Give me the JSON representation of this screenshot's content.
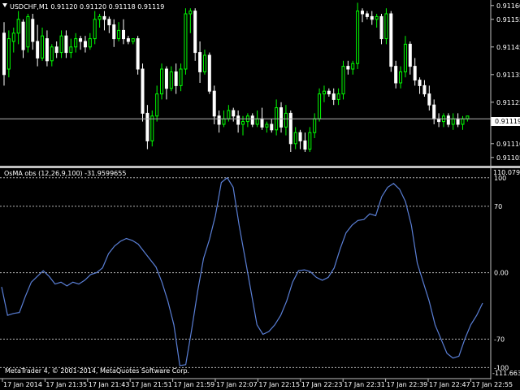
{
  "colors": {
    "background": "#000000",
    "bull_candle": "#00ff00",
    "bear_candle": "#ffffff",
    "osma_line": "#5a7fd6",
    "grid": "#b4b4b4",
    "text": "#ffffff",
    "separator": "#c0c0c0"
  },
  "main_panel": {
    "title": "USDCHF,M1  0.91120 0.91120 0.91118 0.91119",
    "price_ticks": [
      "0.91160",
      "0.91155",
      "0.91145",
      "0.91135",
      "0.91125",
      "0.91110",
      "0.91105"
    ],
    "current_price_label": "0.91119"
  },
  "indicator_panel": {
    "title": "OsMA obs (12,26,9,100) -31.9599655",
    "top_label": "110.0791",
    "bottom_label": "-111.6630",
    "level_labels": [
      "100",
      "70",
      "0.00",
      "-70",
      "-100"
    ]
  },
  "copyright": "MetaTrader 4, © 2001-2014, MetaQuotes Software Corp.",
  "time_labels": [
    "17 Jan 2014",
    "17 Jan 21:35",
    "17 Jan 21:43",
    "17 Jan 21:51",
    "17 Jan 21:59",
    "17 Jan 22:07",
    "17 Jan 22:15",
    "17 Jan 22:23",
    "17 Jan 22:31",
    "17 Jan 22:39",
    "17 Jan 22:47",
    "17 Jan 22:55"
  ],
  "chart_data": [
    {
      "type": "candlestick",
      "title": "USDCHF,M1  0.91120 0.91120 0.91118 0.91119",
      "symbol": "USDCHF",
      "timeframe": "M1",
      "ylim": [
        0.91102,
        0.91162
      ],
      "current_price": 0.91119,
      "candles": [
        {
          "o": 0.9115,
          "h": 0.91154,
          "l": 0.91131,
          "c": 0.91135
        },
        {
          "o": 0.91137,
          "h": 0.91151,
          "l": 0.91134,
          "c": 0.91148
        },
        {
          "o": 0.91147,
          "h": 0.91152,
          "l": 0.91143,
          "c": 0.9115
        },
        {
          "o": 0.9115,
          "h": 0.91158,
          "l": 0.91146,
          "c": 0.91155
        },
        {
          "o": 0.91154,
          "h": 0.91155,
          "l": 0.91141,
          "c": 0.91144
        },
        {
          "o": 0.91145,
          "h": 0.91157,
          "l": 0.91143,
          "c": 0.91156
        },
        {
          "o": 0.91155,
          "h": 0.91157,
          "l": 0.91144,
          "c": 0.91147
        },
        {
          "o": 0.91147,
          "h": 0.91153,
          "l": 0.91138,
          "c": 0.91141
        },
        {
          "o": 0.91141,
          "h": 0.91152,
          "l": 0.9114,
          "c": 0.91149
        },
        {
          "o": 0.91148,
          "h": 0.91151,
          "l": 0.91138,
          "c": 0.9114
        },
        {
          "o": 0.9114,
          "h": 0.91146,
          "l": 0.91138,
          "c": 0.91145
        },
        {
          "o": 0.91145,
          "h": 0.91147,
          "l": 0.91141,
          "c": 0.91143
        },
        {
          "o": 0.91143,
          "h": 0.91151,
          "l": 0.91141,
          "c": 0.91149
        },
        {
          "o": 0.91149,
          "h": 0.91151,
          "l": 0.91141,
          "c": 0.91143
        },
        {
          "o": 0.91143,
          "h": 0.91148,
          "l": 0.91141,
          "c": 0.91145
        },
        {
          "o": 0.91145,
          "h": 0.9115,
          "l": 0.91143,
          "c": 0.91148
        },
        {
          "o": 0.91148,
          "h": 0.91149,
          "l": 0.91144,
          "c": 0.91147
        },
        {
          "o": 0.91147,
          "h": 0.91149,
          "l": 0.91143,
          "c": 0.91145
        },
        {
          "o": 0.91145,
          "h": 0.9115,
          "l": 0.91144,
          "c": 0.91148
        },
        {
          "o": 0.91148,
          "h": 0.91158,
          "l": 0.91146,
          "c": 0.91155
        },
        {
          "o": 0.91155,
          "h": 0.91157,
          "l": 0.91152,
          "c": 0.91156
        },
        {
          "o": 0.91156,
          "h": 0.91158,
          "l": 0.91151,
          "c": 0.91155
        },
        {
          "o": 0.91155,
          "h": 0.91156,
          "l": 0.9115,
          "c": 0.91153
        },
        {
          "o": 0.91153,
          "h": 0.91155,
          "l": 0.91145,
          "c": 0.91148
        },
        {
          "o": 0.91148,
          "h": 0.91154,
          "l": 0.91147,
          "c": 0.91151
        },
        {
          "o": 0.91151,
          "h": 0.91155,
          "l": 0.91146,
          "c": 0.91148
        },
        {
          "o": 0.91148,
          "h": 0.91149,
          "l": 0.91146,
          "c": 0.91147
        },
        {
          "o": 0.91147,
          "h": 0.91148,
          "l": 0.91146,
          "c": 0.91148
        },
        {
          "o": 0.91148,
          "h": 0.91149,
          "l": 0.91135,
          "c": 0.91137
        },
        {
          "o": 0.91137,
          "h": 0.91139,
          "l": 0.91118,
          "c": 0.91121
        },
        {
          "o": 0.91121,
          "h": 0.91124,
          "l": 0.91108,
          "c": 0.91111
        },
        {
          "o": 0.91111,
          "h": 0.91122,
          "l": 0.91109,
          "c": 0.9112
        },
        {
          "o": 0.9112,
          "h": 0.91131,
          "l": 0.91118,
          "c": 0.91128
        },
        {
          "o": 0.91128,
          "h": 0.91139,
          "l": 0.91126,
          "c": 0.91137
        },
        {
          "o": 0.91137,
          "h": 0.91138,
          "l": 0.91126,
          "c": 0.9113
        },
        {
          "o": 0.9113,
          "h": 0.91138,
          "l": 0.91129,
          "c": 0.91136
        },
        {
          "o": 0.91136,
          "h": 0.91139,
          "l": 0.91128,
          "c": 0.91131
        },
        {
          "o": 0.91131,
          "h": 0.91139,
          "l": 0.91129,
          "c": 0.91137
        },
        {
          "o": 0.91137,
          "h": 0.91159,
          "l": 0.91135,
          "c": 0.91157
        },
        {
          "o": 0.91157,
          "h": 0.91159,
          "l": 0.9115,
          "c": 0.91158
        },
        {
          "o": 0.91158,
          "h": 0.91159,
          "l": 0.9114,
          "c": 0.91143
        },
        {
          "o": 0.91143,
          "h": 0.91147,
          "l": 0.91132,
          "c": 0.91136
        },
        {
          "o": 0.91136,
          "h": 0.91144,
          "l": 0.91135,
          "c": 0.91142
        },
        {
          "o": 0.91142,
          "h": 0.91143,
          "l": 0.91128,
          "c": 0.91129
        },
        {
          "o": 0.91129,
          "h": 0.91131,
          "l": 0.91117,
          "c": 0.9112
        },
        {
          "o": 0.9112,
          "h": 0.91122,
          "l": 0.91114,
          "c": 0.91117
        },
        {
          "o": 0.91117,
          "h": 0.91122,
          "l": 0.91116,
          "c": 0.91119
        },
        {
          "o": 0.91119,
          "h": 0.91124,
          "l": 0.91118,
          "c": 0.91122
        },
        {
          "o": 0.91122,
          "h": 0.91123,
          "l": 0.91118,
          "c": 0.9112
        },
        {
          "o": 0.9112,
          "h": 0.91122,
          "l": 0.91114,
          "c": 0.91117
        },
        {
          "o": 0.91117,
          "h": 0.9112,
          "l": 0.91113,
          "c": 0.91118
        },
        {
          "o": 0.91118,
          "h": 0.91121,
          "l": 0.91116,
          "c": 0.9112
        },
        {
          "o": 0.9112,
          "h": 0.91121,
          "l": 0.91116,
          "c": 0.91117
        },
        {
          "o": 0.91117,
          "h": 0.91122,
          "l": 0.91116,
          "c": 0.91119
        },
        {
          "o": 0.91119,
          "h": 0.91123,
          "l": 0.91115,
          "c": 0.91116
        },
        {
          "o": 0.91116,
          "h": 0.91118,
          "l": 0.91114,
          "c": 0.91117
        },
        {
          "o": 0.91117,
          "h": 0.91119,
          "l": 0.91114,
          "c": 0.91115
        },
        {
          "o": 0.91115,
          "h": 0.91126,
          "l": 0.91113,
          "c": 0.91123
        },
        {
          "o": 0.91123,
          "h": 0.91125,
          "l": 0.91114,
          "c": 0.91116
        },
        {
          "o": 0.91116,
          "h": 0.91124,
          "l": 0.91113,
          "c": 0.91121
        },
        {
          "o": 0.91121,
          "h": 0.91122,
          "l": 0.91107,
          "c": 0.9111
        },
        {
          "o": 0.9111,
          "h": 0.91116,
          "l": 0.91108,
          "c": 0.91114
        },
        {
          "o": 0.91114,
          "h": 0.91115,
          "l": 0.91108,
          "c": 0.91111
        },
        {
          "o": 0.91111,
          "h": 0.91114,
          "l": 0.91107,
          "c": 0.91108
        },
        {
          "o": 0.91108,
          "h": 0.91116,
          "l": 0.91107,
          "c": 0.91114
        },
        {
          "o": 0.91114,
          "h": 0.91121,
          "l": 0.91112,
          "c": 0.91119
        },
        {
          "o": 0.91119,
          "h": 0.9113,
          "l": 0.91118,
          "c": 0.91128
        },
        {
          "o": 0.91128,
          "h": 0.91131,
          "l": 0.91125,
          "c": 0.91129
        },
        {
          "o": 0.91129,
          "h": 0.9113,
          "l": 0.91127,
          "c": 0.91128
        },
        {
          "o": 0.91128,
          "h": 0.9113,
          "l": 0.91124,
          "c": 0.91126
        },
        {
          "o": 0.91126,
          "h": 0.9113,
          "l": 0.91124,
          "c": 0.91128
        },
        {
          "o": 0.91128,
          "h": 0.9114,
          "l": 0.91126,
          "c": 0.91138
        },
        {
          "o": 0.91138,
          "h": 0.9114,
          "l": 0.91135,
          "c": 0.91137
        },
        {
          "o": 0.91137,
          "h": 0.9114,
          "l": 0.91135,
          "c": 0.91139
        },
        {
          "o": 0.91139,
          "h": 0.91161,
          "l": 0.91137,
          "c": 0.91158
        },
        {
          "o": 0.91158,
          "h": 0.91159,
          "l": 0.91154,
          "c": 0.91157
        },
        {
          "o": 0.91157,
          "h": 0.91158,
          "l": 0.91155,
          "c": 0.91156
        },
        {
          "o": 0.91156,
          "h": 0.91158,
          "l": 0.91153,
          "c": 0.91155
        },
        {
          "o": 0.91155,
          "h": 0.91157,
          "l": 0.91152,
          "c": 0.91156
        },
        {
          "o": 0.91156,
          "h": 0.91157,
          "l": 0.91146,
          "c": 0.91148
        },
        {
          "o": 0.91148,
          "h": 0.91159,
          "l": 0.91146,
          "c": 0.91157
        },
        {
          "o": 0.91157,
          "h": 0.91158,
          "l": 0.91136,
          "c": 0.91138
        },
        {
          "o": 0.91138,
          "h": 0.9114,
          "l": 0.9113,
          "c": 0.91132
        },
        {
          "o": 0.91132,
          "h": 0.91138,
          "l": 0.9113,
          "c": 0.91136
        },
        {
          "o": 0.91136,
          "h": 0.91149,
          "l": 0.91134,
          "c": 0.91146
        },
        {
          "o": 0.91146,
          "h": 0.91147,
          "l": 0.91135,
          "c": 0.91138
        },
        {
          "o": 0.91138,
          "h": 0.91141,
          "l": 0.91131,
          "c": 0.91133
        },
        {
          "o": 0.91133,
          "h": 0.91134,
          "l": 0.91128,
          "c": 0.91131
        },
        {
          "o": 0.91131,
          "h": 0.91133,
          "l": 0.91127,
          "c": 0.91128
        },
        {
          "o": 0.91128,
          "h": 0.91131,
          "l": 0.91122,
          "c": 0.91124
        },
        {
          "o": 0.91124,
          "h": 0.91126,
          "l": 0.91117,
          "c": 0.91119
        },
        {
          "o": 0.91119,
          "h": 0.91121,
          "l": 0.91116,
          "c": 0.91118
        },
        {
          "o": 0.91118,
          "h": 0.91121,
          "l": 0.91116,
          "c": 0.9112
        },
        {
          "o": 0.9112,
          "h": 0.91121,
          "l": 0.91116,
          "c": 0.91117
        },
        {
          "o": 0.91117,
          "h": 0.91121,
          "l": 0.91115,
          "c": 0.91119
        },
        {
          "o": 0.91119,
          "h": 0.91121,
          "l": 0.91116,
          "c": 0.91117
        },
        {
          "o": 0.91117,
          "h": 0.9112,
          "l": 0.91115,
          "c": 0.91119
        },
        {
          "o": 0.91119,
          "h": 0.9112,
          "l": 0.91118,
          "c": 0.9112
        }
      ]
    },
    {
      "type": "line",
      "title": "OsMA obs (12,26,9,100) -31.9599655",
      "ylim": [
        -111.663,
        110.0791
      ],
      "levels": [
        100,
        70,
        0,
        -70,
        -100
      ],
      "series": [
        {
          "name": "OsMA obs",
          "values": [
            -15,
            -45,
            -43,
            -42,
            -25,
            -10,
            -4,
            2,
            -4,
            -12,
            -10,
            -14,
            -10,
            -12,
            -8,
            -2,
            0,
            5,
            20,
            28,
            33,
            36,
            34,
            30,
            22,
            14,
            6,
            -10,
            -30,
            -55,
            -98,
            -97,
            -60,
            -20,
            15,
            35,
            60,
            95,
            100,
            90,
            50,
            15,
            -20,
            -55,
            -65,
            -62,
            -55,
            -45,
            -30,
            -10,
            2,
            3,
            1,
            -5,
            -8,
            -5,
            5,
            25,
            42,
            50,
            55,
            56,
            62,
            60,
            80,
            90,
            94,
            88,
            75,
            50,
            10,
            -10,
            -30,
            -55,
            -70,
            -85,
            -90,
            -88,
            -70,
            -55,
            -45,
            -32
          ]
        }
      ]
    }
  ]
}
